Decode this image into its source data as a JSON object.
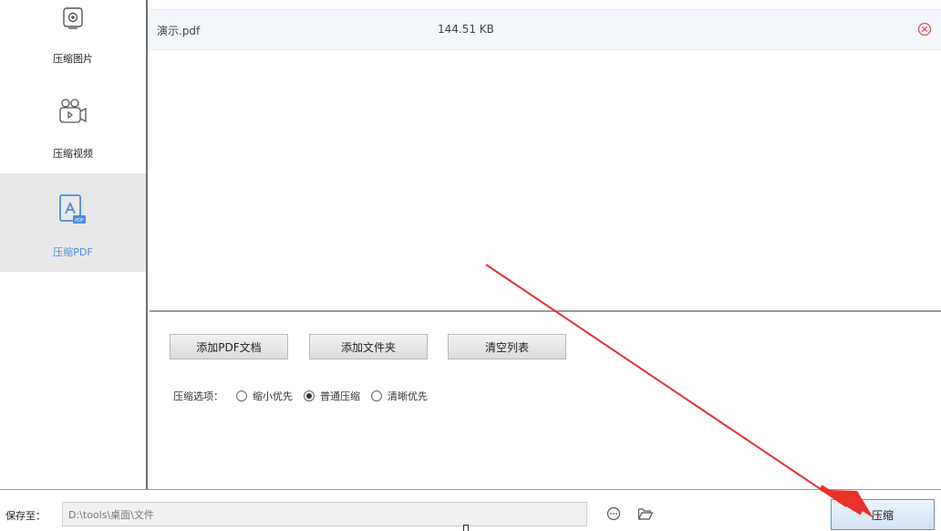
{
  "sidebar": {
    "items": [
      {
        "label": "压缩图片",
        "icon": "image-compress-icon"
      },
      {
        "label": "压缩视频",
        "icon": "video-compress-icon"
      },
      {
        "label": "压缩PDF",
        "icon": "pdf-compress-icon",
        "active": true
      }
    ]
  },
  "file_list": {
    "rows": [
      {
        "name": "演示.pdf",
        "size": "144.51 KB"
      }
    ]
  },
  "actions": {
    "add_pdf": "添加PDF文档",
    "add_folder": "添加文件夹",
    "clear_list": "清空列表"
  },
  "compress_options": {
    "label": "压缩选项：",
    "options": [
      "缩小优先",
      "普通压缩",
      "清晰优先"
    ],
    "selected": "普通压缩"
  },
  "bottom": {
    "save_label": "保存至：",
    "save_path": "D:\\tools\\桌面\\文件",
    "compress_button": "压缩"
  },
  "colors": {
    "accent": "#4a8be0",
    "annotation_arrow": "#e8322b",
    "remove_icon": "#e05050"
  }
}
